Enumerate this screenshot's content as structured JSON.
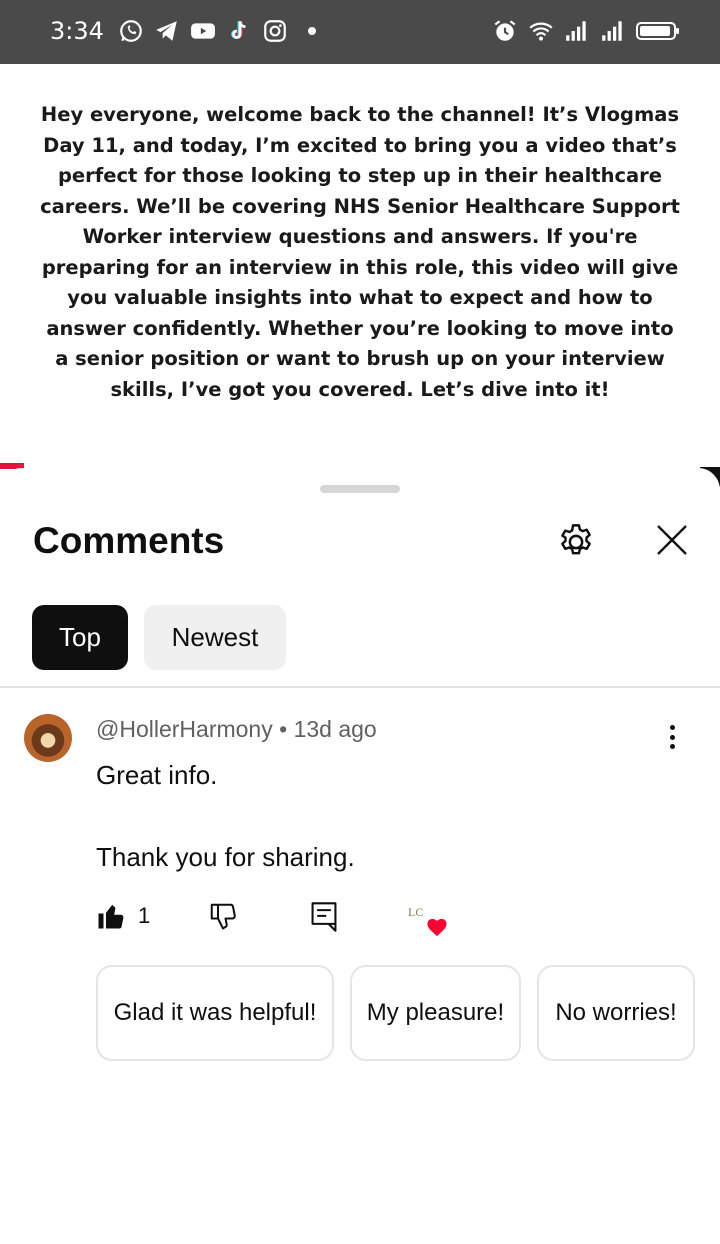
{
  "status_bar": {
    "time": "3:34",
    "left_icons": [
      "whatsapp-icon",
      "telegram-icon",
      "youtube-icon",
      "tiktok-icon",
      "instagram-icon"
    ],
    "right_icons": [
      "alarm-icon",
      "wifi-icon",
      "signal-icon",
      "signal-icon",
      "battery-icon"
    ]
  },
  "video": {
    "description_text": "Hey everyone, welcome back to the channel! It’s Vlogmas Day 11, and today, I’m excited to bring you a video that’s perfect for those looking to step up in their healthcare careers. We’ll be covering NHS Senior Healthcare Support Worker interview questions and answers. If you're preparing for an interview in this role, this video will give you valuable insights into what to expect and how to answer confidently. Whether you’re looking to move into a senior position or want to brush up on your interview skills, I’ve got you covered. Let’s dive into it!"
  },
  "comments_sheet": {
    "title": "Comments",
    "settings_icon": "gear-icon",
    "close_icon": "close-icon",
    "sort_chips": [
      {
        "label": "Top",
        "active": true
      },
      {
        "label": "Newest",
        "active": false
      }
    ],
    "comment": {
      "author": "@HollerHarmony",
      "separator": "•",
      "age": "13d ago",
      "line1": "Great info.",
      "line2": "Thank you for sharing.",
      "like_count": "1",
      "creator_initials": "LC",
      "heart_color": "#ff0033"
    },
    "suggested_replies": [
      "Glad it was helpful!",
      "My pleasure!",
      "No worries!"
    ]
  },
  "colors": {
    "status_bar_bg": "#4a4a4a",
    "accent_red": "#e0143c",
    "chip_active_bg": "#0f0f0f",
    "chip_inactive_bg": "#f0f0f0"
  }
}
